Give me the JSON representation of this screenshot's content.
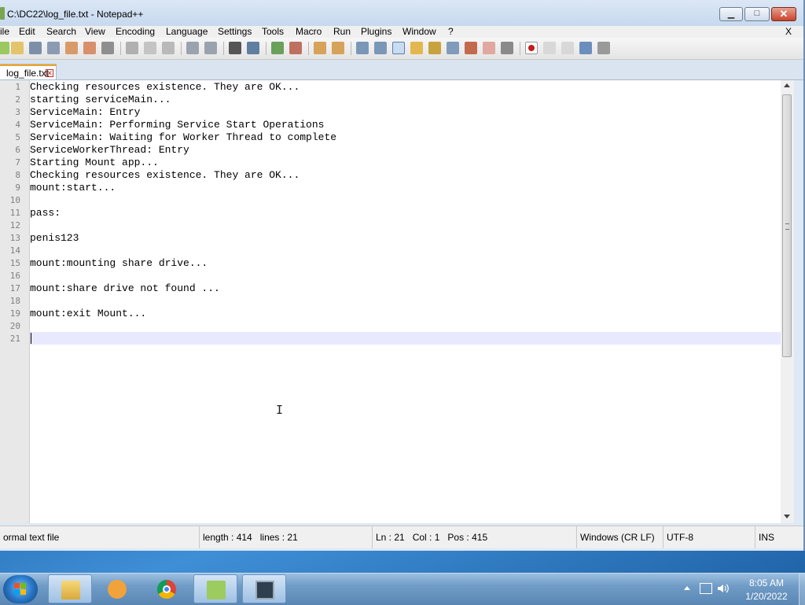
{
  "window": {
    "title": "C:\\DC22\\log_file.txt - Notepad++",
    "controls": {
      "minimize": "▁",
      "maximize": "□",
      "close": "✕"
    }
  },
  "menu": {
    "items": [
      "ile",
      "Edit",
      "Search",
      "View",
      "Encoding",
      "Language",
      "Settings",
      "Tools",
      "Macro",
      "Run",
      "Plugins",
      "Window",
      "?"
    ],
    "close_doc": "X"
  },
  "toolbar": {
    "icons": [
      "new-file-icon",
      "open-file-icon",
      "save-icon",
      "save-all-icon",
      "close-icon",
      "close-all-icon",
      "print-icon",
      "cut-icon",
      "copy-icon",
      "paste-icon",
      "undo-icon",
      "redo-icon",
      "find-icon",
      "replace-icon",
      "zoom-in-icon",
      "zoom-out-icon",
      "sync-vertical-icon",
      "sync-horizontal-icon",
      "word-wrap-icon",
      "show-all-characters-icon",
      "indent-guide-icon",
      "user-language-icon",
      "doc-map-icon",
      "function-list-icon",
      "folder-as-workspace-icon",
      "monitoring-icon",
      "record-macro-icon",
      "stop-record-icon",
      "playback-icon",
      "run-macro-multiple-icon",
      "save-macro-icon"
    ]
  },
  "tabs": [
    {
      "label": "log_file.txt",
      "active": true
    }
  ],
  "editor": {
    "lines": [
      "Checking resources existence. They are OK...",
      "starting serviceMain...",
      "ServiceMain: Entry",
      "ServiceMain: Performing Service Start Operations",
      "ServiceMain: Waiting for Worker Thread to complete",
      "ServiceWorkerThread: Entry",
      "Starting Mount app...",
      "Checking resources existence. They are OK...",
      "mount:start...",
      "",
      "pass:",
      "",
      "penis123",
      "",
      "mount:mounting share drive...",
      "",
      "mount:share drive not found ...",
      "",
      "mount:exit Mount...",
      "",
      ""
    ],
    "line_numbers": [
      "1",
      "2",
      "3",
      "4",
      "5",
      "6",
      "7",
      "8",
      "9",
      "10",
      "11",
      "12",
      "13",
      "14",
      "15",
      "16",
      "17",
      "18",
      "19",
      "20",
      "21"
    ],
    "current_line": 21
  },
  "statusbar": {
    "file_type": "ormal text file",
    "length": "length : 414",
    "lines": "lines : 21",
    "ln": "Ln : 21",
    "col": "Col : 1",
    "pos": "Pos : 415",
    "eol": "Windows (CR LF)",
    "encoding": "UTF-8",
    "mode": "INS"
  },
  "taskbar": {
    "apps": [
      "windows-explorer",
      "windows-media-player",
      "google-chrome",
      "notepad-plus-plus",
      "terminal-app"
    ],
    "active_app": "notepad-plus-plus",
    "time": "8:05 AM",
    "date": "1/20/2022"
  },
  "colors": {
    "current_line": "#e8e8ff",
    "tab_accent": "#f7a41d",
    "line_number": "#808080"
  }
}
